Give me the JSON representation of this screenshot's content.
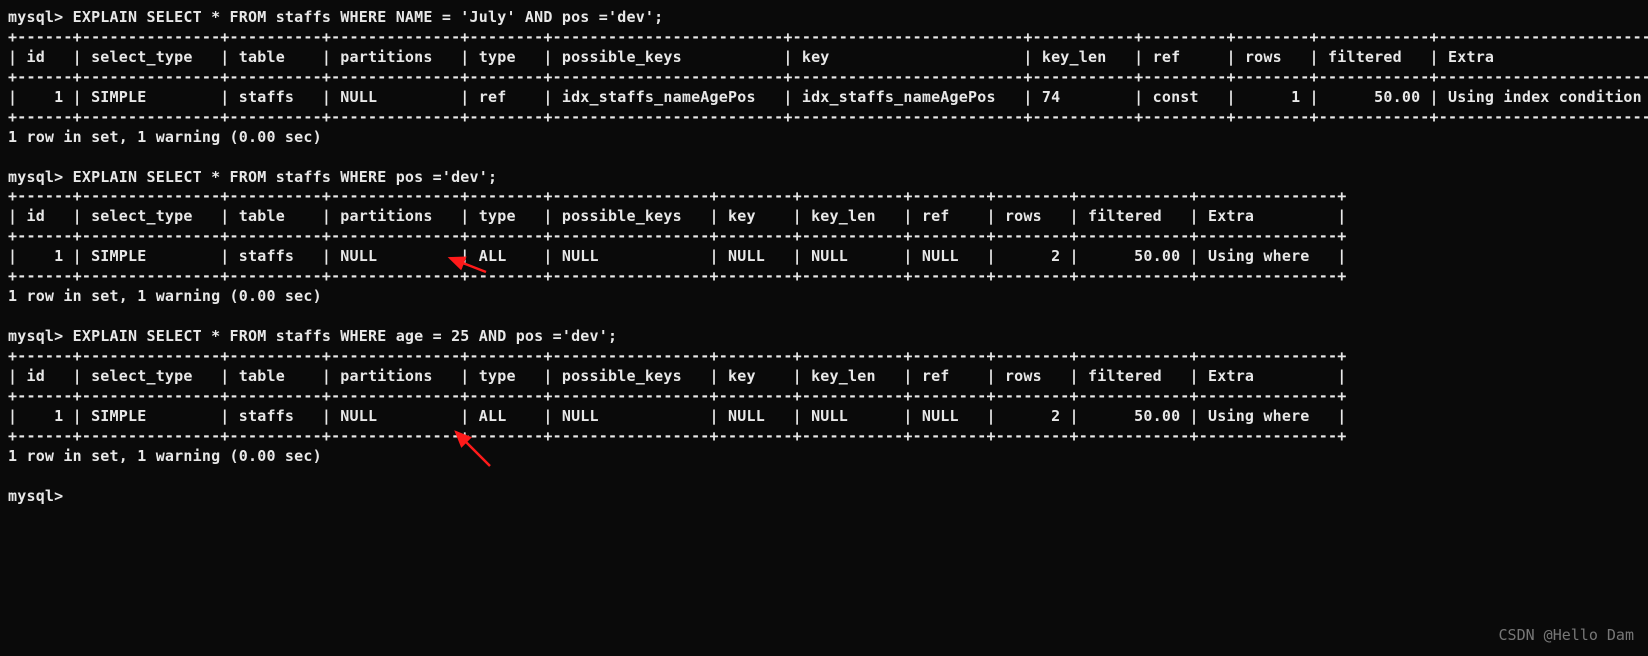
{
  "prompt": "mysql>",
  "queries": [
    {
      "sql": "EXPLAIN SELECT * FROM staffs WHERE NAME = 'July' AND pos ='dev';",
      "headers": [
        "id",
        "select_type",
        "table",
        "partitions",
        "type",
        "possible_keys",
        "key",
        "key_len",
        "ref",
        "rows",
        "filtered",
        "Extra"
      ],
      "row": [
        "1",
        "SIMPLE",
        "staffs",
        "NULL",
        "ref",
        "idx_staffs_nameAgePos",
        "idx_staffs_nameAgePos",
        "74",
        "const",
        "1",
        "50.00",
        "Using index condition"
      ],
      "footer": "1 row in set, 1 warning (0.00 sec)"
    },
    {
      "sql": "EXPLAIN SELECT * FROM staffs WHERE pos ='dev';",
      "headers": [
        "id",
        "select_type",
        "table",
        "partitions",
        "type",
        "possible_keys",
        "key",
        "key_len",
        "ref",
        "rows",
        "filtered",
        "Extra"
      ],
      "row": [
        "1",
        "SIMPLE",
        "staffs",
        "NULL",
        "ALL",
        "NULL",
        "NULL",
        "NULL",
        "NULL",
        "2",
        "50.00",
        "Using where"
      ],
      "footer": "1 row in set, 1 warning (0.00 sec)"
    },
    {
      "sql": "EXPLAIN SELECT * FROM staffs WHERE age = 25 AND pos ='dev';",
      "headers": [
        "id",
        "select_type",
        "table",
        "partitions",
        "type",
        "possible_keys",
        "key",
        "key_len",
        "ref",
        "rows",
        "filtered",
        "Extra"
      ],
      "row": [
        "1",
        "SIMPLE",
        "staffs",
        "NULL",
        "ALL",
        "NULL",
        "NULL",
        "NULL",
        "NULL",
        "2",
        "50.00",
        "Using where"
      ],
      "footer": "1 row in set, 1 warning (0.00 sec)"
    }
  ],
  "tables": {
    "widths_q1": [
      4,
      13,
      8,
      12,
      6,
      23,
      23,
      9,
      7,
      6,
      10,
      23
    ],
    "widths_q2": [
      4,
      13,
      8,
      12,
      6,
      15,
      6,
      9,
      6,
      6,
      10,
      13
    ],
    "widths_q3": [
      4,
      13,
      8,
      12,
      6,
      15,
      6,
      9,
      6,
      6,
      10,
      13
    ]
  },
  "right_align": {
    "id": true,
    "rows": true,
    "filtered": true
  },
  "watermark": "CSDN @Hello Dam"
}
